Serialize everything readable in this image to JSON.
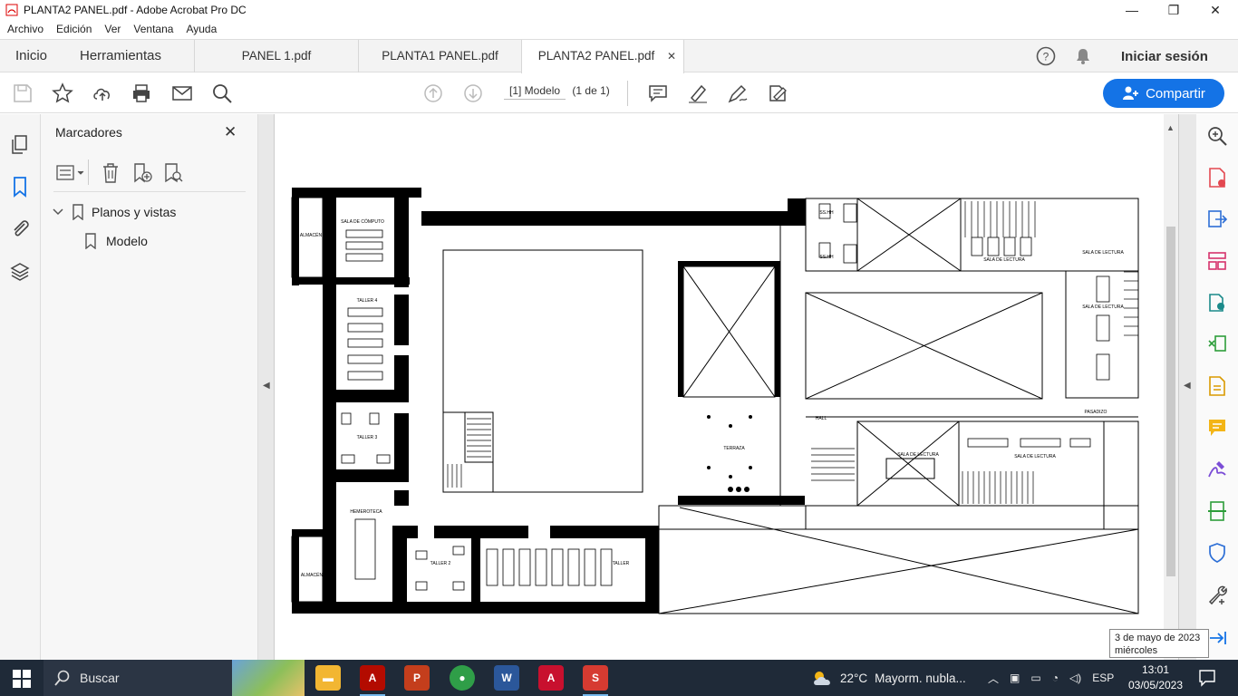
{
  "window": {
    "title": "PLANTA2 PANEL.pdf - Adobe Acrobat Pro DC",
    "minimize": "—",
    "maximize": "❐",
    "close": "✕"
  },
  "menu": [
    "Archivo",
    "Edición",
    "Ver",
    "Ventana",
    "Ayuda"
  ],
  "nav": {
    "home": "Inicio",
    "tools": "Herramientas"
  },
  "tabs": [
    {
      "label": "PANEL 1.pdf"
    },
    {
      "label": "PLANTA1 PANEL.pdf"
    },
    {
      "label": "PLANTA2 PANEL.pdf",
      "close": "✕"
    }
  ],
  "account": {
    "signin": "Iniciar sesión"
  },
  "toolbar": {
    "page_label": "[1] Modelo",
    "page_count": "(1 de 1)",
    "share_label": "Compartir"
  },
  "bookmarks": {
    "title": "Marcadores",
    "close": "✕",
    "items": [
      {
        "label": "Planos y vistas",
        "expanded": true
      },
      {
        "label": "Modelo"
      }
    ]
  },
  "plan_labels": {
    "almacen1": "ALMACÉN",
    "sala_computo": "SALA DE CÓMPUTO",
    "taller4": "TALLER 4",
    "taller3": "TALLER 3",
    "hemeroteca": "HEMEROTECA",
    "almacen2": "ALMACÉN",
    "taller2": "TALLER 2",
    "taller1": "TALLER",
    "ssHH1": "SS.HH",
    "ssHH2": "SS.HH",
    "sala_lectura1": "SALA DE LECTURA",
    "sala_lectura2": "SALA DE LECTURA",
    "sala_lectura3": "SALA DE LECTURA",
    "sala_lectura4": "SALA DE LECTURA",
    "sala_lectura5": "SALA DE LECTURA",
    "hall": "HALL",
    "terraza": "TERRAZA",
    "pasadizo": "PASADIZO"
  },
  "taskbar": {
    "search": "Buscar",
    "weather_temp": "22°C",
    "weather_desc": "Mayorm. nubla...",
    "lang": "ESP",
    "time": "13:01",
    "date": "03/05/2023",
    "apps": [
      {
        "name": "file-explorer",
        "color": "#f2b632"
      },
      {
        "name": "acrobat-reader",
        "color": "#b30b00"
      },
      {
        "name": "powerpoint",
        "color": "#c43e1c"
      },
      {
        "name": "chrome",
        "color": "#2f9e48"
      },
      {
        "name": "word",
        "color": "#2b579a"
      },
      {
        "name": "autocad",
        "color": "#c8102e"
      },
      {
        "name": "sketchup",
        "color": "#d63b31"
      }
    ]
  },
  "tooltip": {
    "line1": "3 de mayo de 2023",
    "line2": "miércoles"
  },
  "colors": {
    "accent": "#1473e6",
    "taskbar": "#1f2a38"
  }
}
